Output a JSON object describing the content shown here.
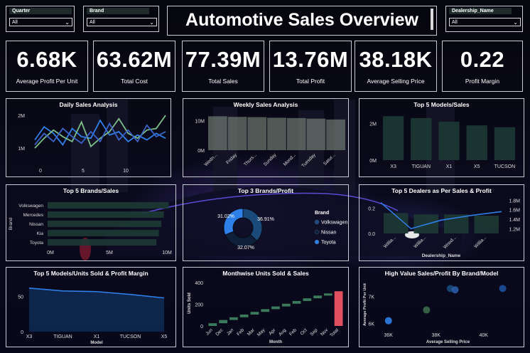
{
  "title": "Automotive Sales Overview",
  "slicers": [
    {
      "label": "Quarter",
      "value": "All"
    },
    {
      "label": "Brand",
      "value": "All"
    },
    {
      "label": "Dealership_Name",
      "value": "All"
    }
  ],
  "kpis": [
    {
      "value": "6.68K",
      "label": "Average Profit Per Unit"
    },
    {
      "value": "63.62M",
      "label": "Total Cost"
    },
    {
      "value": "77.39M",
      "label": "Total Sales"
    },
    {
      "value": "13.76M",
      "label": "Total Profit"
    },
    {
      "value": "38.18K",
      "label": "Average Selling Price"
    },
    {
      "value": "0.22",
      "label": "Profit Margin"
    }
  ],
  "colors": {
    "bar": "#1d3a34",
    "line_blue": "#2f7fe8",
    "line_green": "#7bbf88",
    "accent_red": "#e0505e",
    "white": "#ffffff"
  },
  "chart_data": [
    {
      "type": "line",
      "title": "Daily Sales Analysis",
      "x_ticks": [
        "0",
        "5",
        "10"
      ],
      "y_ticks": [
        "2M",
        "1M"
      ],
      "ylim": [
        0.5,
        2.2
      ],
      "series": [
        {
          "color": "#2f7fe8",
          "x": [
            0,
            1,
            2,
            3,
            4,
            5,
            6,
            7,
            8,
            9,
            10,
            11,
            12,
            13,
            14
          ],
          "values": [
            1.25,
            1.65,
            1.45,
            1.1,
            1.6,
            1.35,
            1.3,
            1.85,
            1.4,
            1.5,
            1.2,
            1.4,
            1.25,
            1.45,
            1.3
          ]
        },
        {
          "color": "#7bbf88",
          "x": [
            0,
            1,
            2,
            3,
            4,
            5,
            6,
            7,
            8,
            9,
            10,
            11,
            12,
            13,
            14
          ],
          "values": [
            1.0,
            1.3,
            1.55,
            1.35,
            1.2,
            1.8,
            1.05,
            1.3,
            1.5,
            1.9,
            1.45,
            1.3,
            1.55,
            1.6,
            2.0
          ]
        },
        {
          "color": "#3a62c8",
          "x": [
            0,
            1,
            2,
            3,
            4,
            5,
            6,
            7,
            8,
            9,
            10,
            11,
            12,
            13,
            14
          ],
          "values": [
            1.1,
            1.45,
            1.2,
            1.6,
            1.35,
            1.15,
            1.5,
            1.2,
            1.75,
            1.25,
            1.55,
            1.2,
            1.7,
            1.35,
            1.5
          ]
        }
      ]
    },
    {
      "type": "bar",
      "title": "Weekly Sales Analysis",
      "categories": [
        "Wedn...",
        "Friday",
        "Thurs...",
        "Sunday",
        "Mond...",
        "Tuesday",
        "Satur..."
      ],
      "values": [
        11.5,
        11.3,
        11.2,
        11.0,
        10.9,
        10.7,
        10.4
      ],
      "y_ticks": [
        "10M",
        "0M"
      ],
      "ylim": [
        0,
        14
      ]
    },
    {
      "type": "bar",
      "title": "Top 5 Models/Sales",
      "categories": [
        "X3",
        "TIGUAN",
        "X1",
        "X5",
        "TUCSON"
      ],
      "values": [
        2.4,
        2.3,
        2.1,
        1.9,
        1.8
      ],
      "y_ticks": [
        "2M",
        "0M"
      ],
      "ylim": [
        0,
        2.8
      ]
    },
    {
      "type": "bar",
      "title": "Top 5 Brands/Sales",
      "ylabel": "Brand",
      "categories": [
        "Volkswagen",
        "Mercedes",
        "Nissan",
        "Kia",
        "Toyota"
      ],
      "values": [
        9.8,
        9.4,
        9.2,
        9.0,
        8.8
      ],
      "x_ticks": [
        "0M",
        "5M",
        "10M"
      ],
      "xlim": [
        0,
        10
      ]
    },
    {
      "type": "pie",
      "title": "Top 3 Brands/Profit",
      "legend_title": "Brand",
      "labels": [
        "Volkswagen",
        "Nissan",
        "Toyota"
      ],
      "values": [
        36.91,
        32.07,
        31.02
      ],
      "data_labels": [
        "36.91%",
        "32.07%",
        "31.02%"
      ],
      "colors": [
        "#1a4a7a",
        "#0e1f3a",
        "#2f7fe8"
      ]
    },
    {
      "type": "bar",
      "title": "Top 5 Dealers as Per Sales & Profit",
      "xlabel": "Dealership_Name",
      "categories": [
        "Willia...",
        "Willia...",
        "Wood...",
        "Willia..."
      ],
      "values": [
        0.16,
        0.15,
        0.15,
        0.14
      ],
      "y_ticks_left": [
        "0.2",
        "0.0"
      ],
      "y_ticks_right": [
        "1.8M",
        "1.6M",
        "1.4M",
        "1.2M"
      ],
      "line_series": {
        "values": [
          1.75,
          1.2,
          1.38,
          1.48,
          1.56
        ]
      },
      "ylim": [
        0,
        0.28
      ],
      "ylim_right": [
        1.1,
        1.85
      ]
    },
    {
      "type": "area",
      "title": "Top 5 Models/Units Sold & Profit Margin",
      "xlabel": "Model",
      "categories": [
        "X3",
        "TIGUAN",
        "X1",
        "TUCSON",
        "X5"
      ],
      "values": [
        62,
        58,
        57,
        53,
        48
      ],
      "y_ticks": [
        "50",
        "0"
      ],
      "ylim": [
        0,
        75
      ]
    },
    {
      "type": "bar",
      "title": "Monthwise Units Sold & Sales",
      "xlabel": "Month",
      "ylabel": "Units Sold",
      "categories": [
        "Jun",
        "Dec",
        "Jan",
        "Feb",
        "Mar",
        "May",
        "Apr",
        "Aug",
        "Feb",
        "Oct",
        "Sep",
        "Nov",
        "Total"
      ],
      "values": [
        25,
        55,
        80,
        105,
        130,
        155,
        180,
        205,
        230,
        255,
        280,
        300,
        320
      ],
      "y_ticks": [
        "400",
        "200",
        "0"
      ],
      "ylim": [
        0,
        420
      ]
    },
    {
      "type": "scatter",
      "title": "High Value Sales/Profit By Brand/Model",
      "xlabel": "Average Selling Price",
      "ylabel": "Average Profit Per Unit",
      "x_ticks": [
        "36K",
        "38K",
        "40K"
      ],
      "y_ticks": [
        "7K",
        "6K"
      ],
      "xlim": [
        35.5,
        41.5
      ],
      "ylim": [
        5.8,
        7.6
      ],
      "points": [
        {
          "x": 36.0,
          "y": 6.1,
          "color": "#2f7fe8"
        },
        {
          "x": 37.6,
          "y": 6.5,
          "color": "#3b6a4a"
        },
        {
          "x": 38.6,
          "y": 7.3,
          "color": "#1a4a7a"
        },
        {
          "x": 38.8,
          "y": 7.25,
          "color": "#2a5ba8"
        },
        {
          "x": 40.8,
          "y": 7.3,
          "color": "#1f4f9a"
        }
      ]
    }
  ]
}
